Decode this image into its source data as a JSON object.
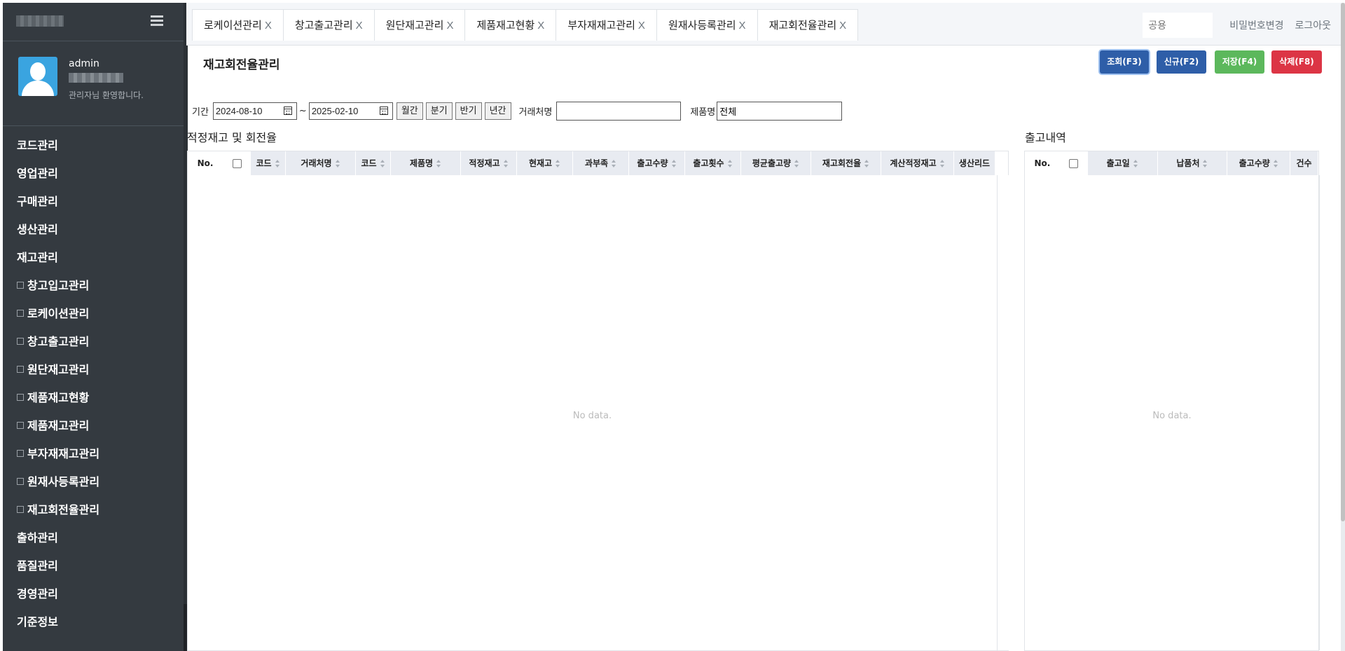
{
  "sidebar": {
    "user": {
      "name": "admin",
      "welcome": "관리자님 환영합니다."
    },
    "menu": [
      {
        "label": "코드관리",
        "sub": false
      },
      {
        "label": "영업관리",
        "sub": false
      },
      {
        "label": "구매관리",
        "sub": false
      },
      {
        "label": "생산관리",
        "sub": false
      },
      {
        "label": "재고관리",
        "sub": false
      },
      {
        "label": "창고입고관리",
        "sub": true
      },
      {
        "label": "로케이션관리",
        "sub": true
      },
      {
        "label": "창고출고관리",
        "sub": true
      },
      {
        "label": "원단재고관리",
        "sub": true
      },
      {
        "label": "제품재고현황",
        "sub": true
      },
      {
        "label": "제품재고관리",
        "sub": true
      },
      {
        "label": "부자재재고관리",
        "sub": true
      },
      {
        "label": "원재사등록관리",
        "sub": true
      },
      {
        "label": "재고회전율관리",
        "sub": true
      },
      {
        "label": "출하관리",
        "sub": false
      },
      {
        "label": "품질관리",
        "sub": false
      },
      {
        "label": "경영관리",
        "sub": false
      },
      {
        "label": "기준정보",
        "sub": false
      }
    ]
  },
  "tabs": [
    {
      "label": "로케이션관리",
      "close": "X"
    },
    {
      "label": "창고출고관리",
      "close": "X"
    },
    {
      "label": "원단재고관리",
      "close": "X"
    },
    {
      "label": "제품재고현황",
      "close": "X"
    },
    {
      "label": "부자재재고관리",
      "close": "X"
    },
    {
      "label": "원재사등록관리",
      "close": "X"
    },
    {
      "label": "재고회전율관리",
      "close": "X"
    }
  ],
  "topbar": {
    "search_placeholder": "공용",
    "change_password": "비밀번호변경",
    "logout": "로그아웃"
  },
  "page": {
    "title": "재고회전율관리"
  },
  "buttons": {
    "search": "조회(F3)",
    "new": "신규(F2)",
    "save": "저장(F4)",
    "delete": "삭제(F8)"
  },
  "filter": {
    "period_label": "기간",
    "date_from": "2024-08-10",
    "tilde": "~",
    "date_to": "2025-02-10",
    "period_buttons": [
      "월간",
      "분기",
      "반기",
      "년간"
    ],
    "client_label": "거래처명",
    "client_value": "",
    "product_label": "제품명",
    "product_value": "전체"
  },
  "left_grid": {
    "title": "적정재고 및 회전율",
    "columns": [
      "No.",
      "",
      "코드",
      "거래처명",
      "코드",
      "제품명",
      "적정재고",
      "현재고",
      "과부족",
      "출고수량",
      "출고횟수",
      "평균출고량",
      "재고회전율",
      "계산적정재고",
      "생산리드"
    ],
    "empty_text": "No data."
  },
  "right_grid": {
    "title": "출고내역",
    "columns": [
      "No.",
      "",
      "출고일",
      "납품처",
      "출고수량",
      "건수"
    ],
    "empty_text": "No data."
  },
  "colors": {
    "sidebar": "#343a40",
    "primary": "#2e5ea8",
    "success": "#5cb85c",
    "danger": "#dc3545"
  }
}
